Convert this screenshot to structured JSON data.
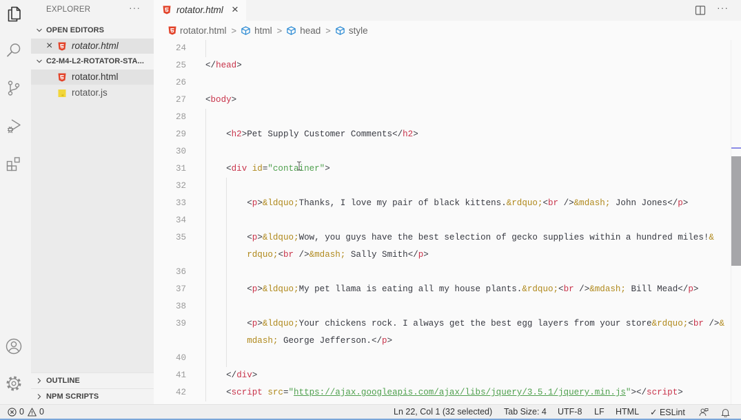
{
  "activity_bar": {
    "top": [
      "explorer-icon",
      "search-icon",
      "source-control-icon",
      "run-debug-icon",
      "extensions-icon"
    ],
    "bottom": [
      "account-icon",
      "gear-icon"
    ],
    "active": "explorer-icon"
  },
  "sidebar": {
    "title": "EXPLORER",
    "more": "···",
    "open_editors": {
      "label": "OPEN EDITORS",
      "items": [
        {
          "label": "rotator.html",
          "icon": "html5-icon",
          "close": "×"
        }
      ]
    },
    "folder": {
      "label": "C2-M4-L2-ROTATOR-STA...",
      "items": [
        {
          "label": "rotator.html",
          "icon": "html5-icon",
          "selected": true
        },
        {
          "label": "rotator.js",
          "icon": "javascript-icon"
        }
      ]
    },
    "outline": "OUTLINE",
    "npm_scripts": "NPM SCRIPTS"
  },
  "tabs": [
    {
      "label": "rotator.html",
      "icon": "html5-icon",
      "close": "×",
      "active": true
    }
  ],
  "group_actions": {
    "split": "split-editor-icon",
    "more": "···"
  },
  "breadcrumb": {
    "separator": ">",
    "items": [
      {
        "label": "rotator.html",
        "icon": "html5-icon"
      },
      {
        "label": "html",
        "icon": "symbol-element-icon"
      },
      {
        "label": "head",
        "icon": "symbol-element-icon"
      },
      {
        "label": "style",
        "icon": "symbol-element-icon"
      }
    ]
  },
  "editor": {
    "colors": {
      "tag": "#c8334a",
      "attribute": "#b0891c",
      "string": "#4fa04e",
      "entity": "#b0891c",
      "text": "#383a42"
    },
    "lines": [
      {
        "n": "24",
        "indent": 0,
        "tokens": []
      },
      {
        "n": "25",
        "indent": 0,
        "tokens": [
          [
            "p",
            "</"
          ],
          [
            "tag",
            "head"
          ],
          [
            "p",
            ">"
          ]
        ]
      },
      {
        "n": "26",
        "indent": 0,
        "tokens": []
      },
      {
        "n": "27",
        "indent": 0,
        "tokens": [
          [
            "p",
            "<"
          ],
          [
            "tag",
            "body"
          ],
          [
            "p",
            ">"
          ]
        ]
      },
      {
        "n": "28",
        "indent": 0,
        "tokens": []
      },
      {
        "n": "29",
        "indent": 4,
        "tokens": [
          [
            "p",
            "<"
          ],
          [
            "tag",
            "h2"
          ],
          [
            "p",
            ">"
          ],
          [
            "txt",
            "Pet Supply Customer Comments"
          ],
          [
            "p",
            "</"
          ],
          [
            "tag",
            "h2"
          ],
          [
            "p",
            ">"
          ]
        ]
      },
      {
        "n": "30",
        "indent": 0,
        "tokens": []
      },
      {
        "n": "31",
        "indent": 4,
        "tokens": [
          [
            "p",
            "<"
          ],
          [
            "tag",
            "div"
          ],
          [
            "txt",
            " "
          ],
          [
            "attr",
            "id"
          ],
          [
            "p",
            "="
          ],
          [
            "str",
            "\"container\""
          ],
          [
            "p",
            ">"
          ]
        ]
      },
      {
        "n": "32",
        "indent": 0,
        "tokens": []
      },
      {
        "n": "33",
        "indent": 8,
        "tokens": [
          [
            "p",
            "<"
          ],
          [
            "tag",
            "p"
          ],
          [
            "p",
            ">"
          ],
          [
            "ent",
            "&ldquo;"
          ],
          [
            "txt",
            "Thanks, I love my pair of black kittens."
          ],
          [
            "ent",
            "&rdquo;"
          ],
          [
            "p",
            "<"
          ],
          [
            "tag",
            "br"
          ],
          [
            "p",
            " />"
          ],
          [
            "ent",
            "&mdash;"
          ],
          [
            "txt",
            " John Jones"
          ],
          [
            "p",
            "</"
          ],
          [
            "tag",
            "p"
          ],
          [
            "p",
            ">"
          ]
        ]
      },
      {
        "n": "34",
        "indent": 0,
        "tokens": []
      },
      {
        "n": "35",
        "indent": 8,
        "tokens": [
          [
            "p",
            "<"
          ],
          [
            "tag",
            "p"
          ],
          [
            "p",
            ">"
          ],
          [
            "ent",
            "&ldquo;"
          ],
          [
            "txt",
            "Wow, you guys have the best selection of gecko supplies within a hundred miles!"
          ],
          [
            "ent",
            "&"
          ]
        ],
        "wrap": [
          [
            "ent",
            "rdquo;"
          ],
          [
            "p",
            "<"
          ],
          [
            "tag",
            "br"
          ],
          [
            "p",
            " />"
          ],
          [
            "ent",
            "&mdash;"
          ],
          [
            "txt",
            " Sally Smith"
          ],
          [
            "p",
            "</"
          ],
          [
            "tag",
            "p"
          ],
          [
            "p",
            ">"
          ]
        ]
      },
      {
        "n": "36",
        "indent": 0,
        "tokens": []
      },
      {
        "n": "37",
        "indent": 8,
        "tokens": [
          [
            "p",
            "<"
          ],
          [
            "tag",
            "p"
          ],
          [
            "p",
            ">"
          ],
          [
            "ent",
            "&ldquo;"
          ],
          [
            "txt",
            "My pet llama is eating all my house plants."
          ],
          [
            "ent",
            "&rdquo;"
          ],
          [
            "p",
            "<"
          ],
          [
            "tag",
            "br"
          ],
          [
            "p",
            " />"
          ],
          [
            "ent",
            "&mdash;"
          ],
          [
            "txt",
            " Bill Mead"
          ],
          [
            "p",
            "</"
          ],
          [
            "tag",
            "p"
          ],
          [
            "p",
            ">"
          ]
        ]
      },
      {
        "n": "38",
        "indent": 0,
        "tokens": []
      },
      {
        "n": "39",
        "indent": 8,
        "tokens": [
          [
            "p",
            "<"
          ],
          [
            "tag",
            "p"
          ],
          [
            "p",
            ">"
          ],
          [
            "ent",
            "&ldquo;"
          ],
          [
            "txt",
            "Your chickens rock. I always get the best egg layers from your store"
          ],
          [
            "ent",
            "&rdquo;"
          ],
          [
            "p",
            "<"
          ],
          [
            "tag",
            "br"
          ],
          [
            "p",
            " />"
          ],
          [
            "ent",
            "&"
          ]
        ],
        "wrap": [
          [
            "ent",
            "mdash;"
          ],
          [
            "txt",
            " George Jefferson."
          ],
          [
            "p",
            "</"
          ],
          [
            "tag",
            "p"
          ],
          [
            "p",
            ">"
          ]
        ]
      },
      {
        "n": "40",
        "indent": 0,
        "tokens": []
      },
      {
        "n": "41",
        "indent": 4,
        "tokens": [
          [
            "p",
            "</"
          ],
          [
            "tag",
            "div"
          ],
          [
            "p",
            ">"
          ]
        ]
      },
      {
        "n": "42",
        "indent": 4,
        "tokens": [
          [
            "p",
            "<"
          ],
          [
            "tag",
            "script"
          ],
          [
            "txt",
            " "
          ],
          [
            "attr",
            "src"
          ],
          [
            "p",
            "="
          ],
          [
            "str",
            "\""
          ],
          [
            "url",
            "https://ajax.googleapis.com/ajax/libs/jquery/3.5.1/jquery.min.js"
          ],
          [
            "str",
            "\""
          ],
          [
            "p",
            "></"
          ],
          [
            "tag",
            "script"
          ],
          [
            "p",
            ">"
          ]
        ]
      }
    ],
    "scrollbar": {
      "thumb_start": 0.32,
      "thumb_size": 0.3,
      "selection_mark": 0.295
    }
  },
  "status_bar": {
    "errors": "0",
    "warnings": "0",
    "cursor_position": "Ln 22, Col 1 (32 selected)",
    "tab_size": "Tab Size: 4",
    "encoding": "UTF-8",
    "eol": "LF",
    "language": "HTML",
    "linter_check": "✓",
    "linter": "ESLint"
  }
}
